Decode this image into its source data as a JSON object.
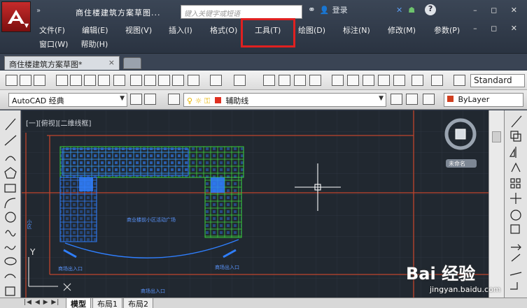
{
  "title_bar": {
    "quick_access": "»",
    "document_title": "商住楼建筑方案草图...",
    "search_placeholder": "键入关键字或短语",
    "login_label": "登录",
    "help_label": "?"
  },
  "menu": {
    "row1": [
      "文件(F)",
      "编辑(E)",
      "视图(V)",
      "插入(I)",
      "格式(O)",
      "工具(T)",
      "绘图(D)",
      "标注(N)",
      "修改(M)",
      "参数(P)"
    ],
    "row2": [
      "窗口(W)",
      "帮助(H)"
    ],
    "highlighted_item": "工具(T)"
  },
  "tabs": {
    "document_tab": "商住楼建筑方案草图*",
    "close": "×"
  },
  "toolbar": {
    "text_style": "Standard",
    "workspace": "AutoCAD 经典",
    "layer": "辅助线",
    "color": "ByLayer",
    "layer_color": "#e03020",
    "bylayer_color": "#d04020"
  },
  "viewport": {
    "label": "[一][俯视][二维线框]",
    "compass_label": "未命名",
    "plaza_label": "商业楼前小区活动广场",
    "entrance_left": "商场出入口",
    "entrance_right": "商场出入口",
    "entrance_bottom": "商场出入口",
    "side_label": "小区"
  },
  "layout_tabs": [
    "模型",
    "布局1",
    "布局2"
  ],
  "watermark": {
    "brand": "Bai 经验",
    "url": "jingyan.baidu.com"
  },
  "colors": {
    "canvas_bg": "#212830",
    "building_blue": "#2f7fff",
    "building_green": "#39d23a",
    "boundary_red": "#c0442c",
    "highlight_red": "#e02020"
  }
}
